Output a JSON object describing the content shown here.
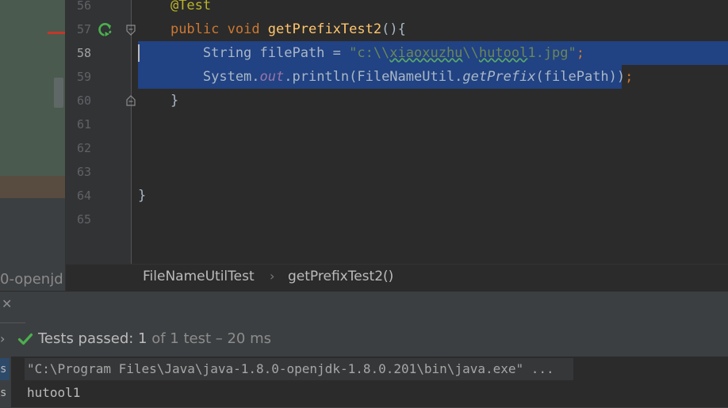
{
  "left_panel": {
    "partial_text": "0-openjd"
  },
  "editor": {
    "lines": [
      {
        "num": "56",
        "segments": [
          {
            "t": "    "
          },
          {
            "t": "@Test",
            "c": "ann"
          }
        ]
      },
      {
        "num": "57",
        "segments": [
          {
            "t": "    "
          },
          {
            "t": "public ",
            "c": "kw"
          },
          {
            "t": "void ",
            "c": "kw"
          },
          {
            "t": "getPrefixTest2",
            "c": "fn"
          },
          {
            "t": "(){"
          }
        ]
      },
      {
        "num": "58",
        "selected": true,
        "segments": [
          {
            "t": "        String filePath = "
          },
          {
            "t": "\"c:\\\\",
            "c": "str"
          },
          {
            "t": "xiaoxuzhu",
            "c": "str sq"
          },
          {
            "t": "\\\\",
            "c": "str"
          },
          {
            "t": "hutool",
            "c": "str sq"
          },
          {
            "t": "1.jpg\"",
            "c": "str"
          },
          {
            "t": ";",
            "c": "kw"
          }
        ]
      },
      {
        "num": "59",
        "selected": true,
        "segments": [
          {
            "t": "        System."
          },
          {
            "t": "out",
            "c": "fld"
          },
          {
            "t": ".println(FileNameUtil."
          },
          {
            "t": "getPrefix",
            "c": "it"
          },
          {
            "t": "(filePath))"
          },
          {
            "t": ";",
            "c": "kw"
          }
        ]
      },
      {
        "num": "60",
        "segments": [
          {
            "t": "    }"
          }
        ]
      },
      {
        "num": "61",
        "segments": []
      },
      {
        "num": "62",
        "segments": []
      },
      {
        "num": "63",
        "segments": []
      },
      {
        "num": "64",
        "segments": [
          {
            "t": "}"
          }
        ]
      },
      {
        "num": "65",
        "segments": []
      }
    ]
  },
  "breadcrumb": {
    "class_name": "FileNameUtilTest",
    "separator": "›",
    "method_name": "getPrefixTest2()"
  },
  "run_window": {
    "close_glyph": "✕",
    "expand_glyph": "›",
    "status_label": "Tests passed: ",
    "status_count": "1",
    "status_rest": " of 1 test – 20 ms",
    "console_side": [
      "s",
      "s"
    ],
    "command_line": "\"C:\\Program Files\\Java\\java-1.8.0-openjdk-1.8.0.201\\bin\\java.exe\" ...",
    "output_line": "hutool1"
  },
  "icons": {
    "run": "run-test-icon",
    "fold": "fold-marker-icon",
    "check": "check-icon"
  },
  "colors": {
    "editor_bg": "#2b2b2b",
    "selection": "#214283",
    "keyword": "#cc7832",
    "string": "#6a8759",
    "method": "#ffc66d",
    "annotation": "#bbb529",
    "pass_green": "#4caf50"
  }
}
